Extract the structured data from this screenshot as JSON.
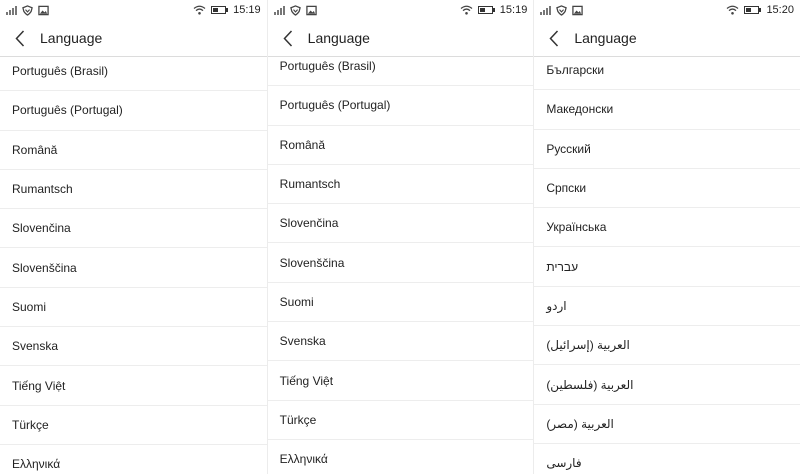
{
  "screens": [
    {
      "status": {
        "time": "15:19"
      },
      "title": "Language",
      "languages": [
        "Português (Brasil)",
        "Português (Portugal)",
        "Română",
        "Rumantsch",
        "Slovenčina",
        "Slovenščina",
        "Suomi",
        "Svenska",
        "Tiếng Việt",
        "Türkçe",
        "Ελληνικά"
      ]
    },
    {
      "status": {
        "time": "15:19"
      },
      "title": "Language",
      "languages": [
        "Português (Brasil)",
        "Português (Portugal)",
        "Română",
        "Rumantsch",
        "Slovenčina",
        "Slovenščina",
        "Suomi",
        "Svenska",
        "Tiếng Việt",
        "Türkçe",
        "Ελληνικά"
      ]
    },
    {
      "status": {
        "time": "15:20"
      },
      "title": "Language",
      "languages": [
        "Български",
        "Македонски",
        "Русский",
        "Српски",
        "Українська",
        "עברית",
        "اردو",
        "العربية (إسرائيل)",
        "العربية (فلسطين)",
        "العربية (مصر)",
        "فارسی"
      ]
    }
  ],
  "icons": {
    "signal": "signal-icon",
    "notification": "shield-icon",
    "image": "image-icon",
    "wifi": "wifi-icon",
    "battery": "battery-icon",
    "back": "back-arrow-icon"
  }
}
